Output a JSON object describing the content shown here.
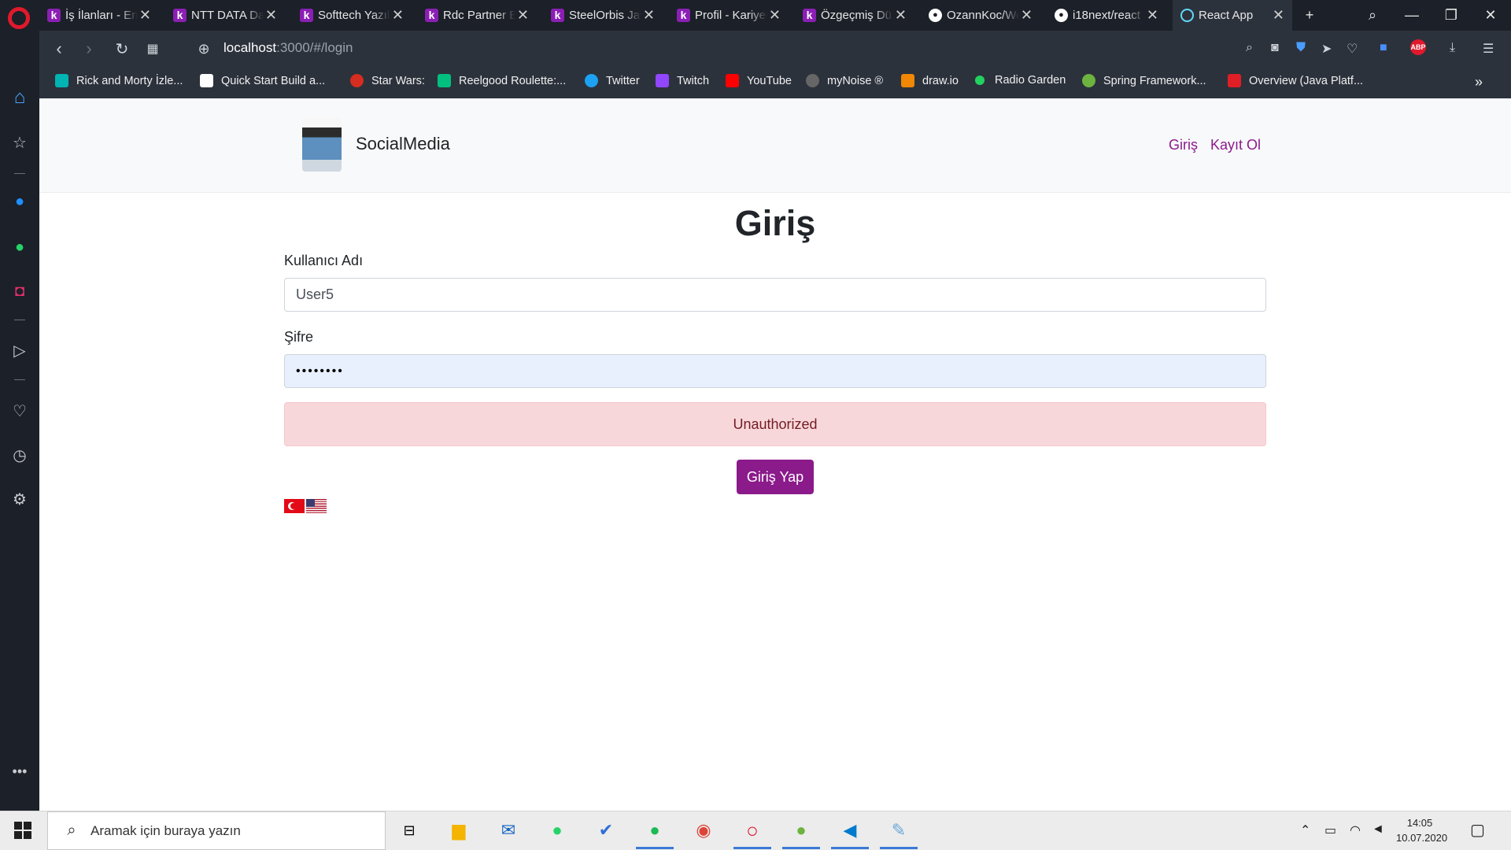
{
  "browser": {
    "tabs": [
      {
        "title": "İş İlanları - En",
        "icon": "k-favicon"
      },
      {
        "title": "NTT DATA Da",
        "icon": "k-favicon"
      },
      {
        "title": "Softtech Yazılı",
        "icon": "k-favicon"
      },
      {
        "title": "Rdc Partner Bi",
        "icon": "k-favicon"
      },
      {
        "title": "SteelOrbis Jav",
        "icon": "k-favicon"
      },
      {
        "title": "Profil - Kariyer",
        "icon": "k-favicon"
      },
      {
        "title": "Özgeçmiş Düz",
        "icon": "k-favicon"
      },
      {
        "title": "OzannKoc/We",
        "icon": "github-favicon"
      },
      {
        "title": "i18next/react",
        "icon": "github-favicon"
      },
      {
        "title": "React App",
        "icon": "react-favicon",
        "active": true
      }
    ],
    "url_host": "localhost",
    "url_path": ":3000/#/login",
    "bookmarks": [
      {
        "label": "Rick and Morty İzle...",
        "color": "#00b4b4"
      },
      {
        "label": "Quick Start Build a...",
        "color": "#ffffff"
      },
      {
        "label": "Star Wars:",
        "color": "#d62d20"
      },
      {
        "label": "Reelgood Roulette:...",
        "color": "#00c07f"
      },
      {
        "label": "Twitter",
        "color": "#1da1f2"
      },
      {
        "label": "Twitch",
        "color": "#9146ff"
      },
      {
        "label": "YouTube",
        "color": "#ff0000"
      },
      {
        "label": "myNoise ®",
        "color": "#666666"
      },
      {
        "label": "draw.io",
        "color": "#f08705"
      },
      {
        "label": "Radio Garden",
        "color": "#23d160"
      },
      {
        "label": "Spring Framework...",
        "color": "#6db33f"
      },
      {
        "label": "Overview (Java Platf...",
        "color": "#e01e26"
      }
    ]
  },
  "app": {
    "brand": "SocialMedia",
    "nav_login": "Giriş",
    "nav_signup": "Kayıt Ol",
    "page_title": "Giriş",
    "username_label": "Kullanıcı Adı",
    "username_value": "User5",
    "password_label": "Şifre",
    "password_value": "••••••••",
    "error_message": "Unauthorized",
    "submit_label": "Giriş Yap",
    "accent_color": "#8b1a8b",
    "error_bg": "#f8d7da"
  },
  "taskbar": {
    "search_placeholder": "Aramak için buraya yazın",
    "time": "14:05",
    "date": "10.07.2020"
  }
}
